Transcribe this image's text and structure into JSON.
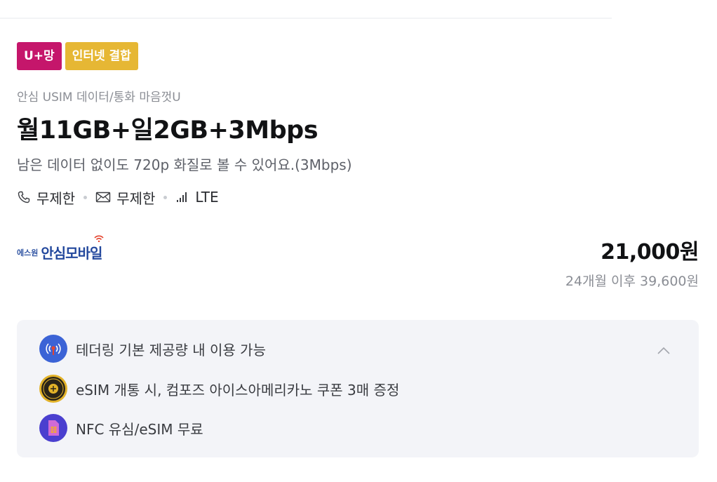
{
  "badges": {
    "network": "U+망",
    "bundle": "인터넷 결합"
  },
  "plan": {
    "subtitle": "안심 USIM 데이터/통화 마음껏U",
    "title": "월11GB+일2GB+3Mbps",
    "description": "남은 데이터 없이도 720p 화질로 볼 수 있어요.(3Mbps)"
  },
  "specs": {
    "call": "무제한",
    "sms": "무제한",
    "network": "LTE"
  },
  "provider": {
    "logo_prefix": "에스원",
    "logo_name": "안심모바일"
  },
  "pricing": {
    "price": "21,000원",
    "after": "24개월 이후 39,600원"
  },
  "benefits": [
    {
      "icon": "tethering-icon",
      "text": "테더링 기본 제공량 내 이용 가능"
    },
    {
      "icon": "compose-coffee-icon",
      "text": "eSIM 개통 시, 컴포즈 아이스아메리카노 쿠폰 3매 증정"
    },
    {
      "icon": "sim-card-icon",
      "text": "NFC 유심/eSIM 무료"
    }
  ],
  "colors": {
    "network_badge": "#c5166b",
    "bundle_badge": "#e6b734",
    "benefit_panel": "#f3f4f8"
  }
}
